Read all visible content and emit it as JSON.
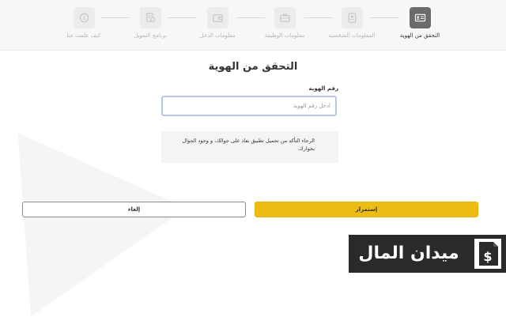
{
  "steps": [
    {
      "label": "التحقق من الهوية",
      "icon": "id-card-icon",
      "active": true
    },
    {
      "label": "المعلومات الشخصية",
      "icon": "profile-document-icon",
      "active": false
    },
    {
      "label": "معلومات الوظيفة",
      "icon": "briefcase-icon",
      "active": false
    },
    {
      "label": "معلومات الدخل",
      "icon": "wallet-icon",
      "active": false
    },
    {
      "label": "برنامج التمويل",
      "icon": "finance-program-icon",
      "active": false
    },
    {
      "label": "كيف علمت عنا",
      "icon": "info-icon",
      "active": false
    }
  ],
  "form": {
    "title": "التحقق من الهوية",
    "id_label": "رقم الهوية",
    "id_placeholder": "أدخل رقم الهوية",
    "notice": "الرجاء التأكد من تحميل تطبيق نفاذ على جوالك، و وجود الجوال بجوارك."
  },
  "buttons": {
    "continue": "إستمرار",
    "cancel": "إلغاء"
  },
  "logo": {
    "text": "ميدان المال"
  },
  "colors": {
    "accent": "#eebd13",
    "active_step": "#6b6b6b",
    "logo_bg": "#2a2a2a"
  }
}
